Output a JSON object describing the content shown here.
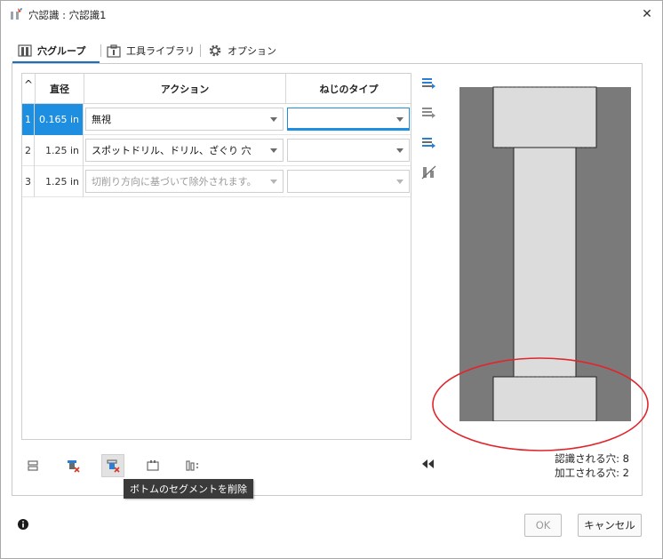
{
  "window": {
    "title": "穴認識 : 穴認識1",
    "close_glyph": "✕"
  },
  "tabs": [
    {
      "label": "穴グループ",
      "icon": "hole-group-icon",
      "active": true
    },
    {
      "label": "工具ライブラリ",
      "icon": "tool-library-icon",
      "active": false
    },
    {
      "label": "オプション",
      "icon": "gear-icon",
      "active": false
    }
  ],
  "grid": {
    "columns": [
      "",
      "直径",
      "アクション",
      "ねじのタイプ"
    ],
    "sort_glyph": "^",
    "rows": [
      {
        "num": "1",
        "diameter": "0.165 in",
        "action": "無視",
        "thread": "",
        "selected": true,
        "disabled": false
      },
      {
        "num": "2",
        "diameter": "1.25 in",
        "action": "スポットドリル、ドリル、ざぐり 穴",
        "thread": "",
        "selected": false,
        "disabled": false
      },
      {
        "num": "3",
        "diameter": "1.25 in",
        "action": "切削り方向に基づいて除外されます。",
        "thread": "",
        "selected": false,
        "disabled": true
      }
    ]
  },
  "side_icons": [
    "merge-groups-icon",
    "split-group-icon",
    "move-group-icon",
    "toggle-segments-icon"
  ],
  "bottom_toolbar": {
    "icons": [
      "segment-top-icon",
      "delete-top-segment-icon",
      "delete-bottom-segment-icon",
      "segment-edit-icon",
      "segment-align-icon"
    ],
    "tooltip": "ボトムのセグメントを削除"
  },
  "counts": {
    "recognized": "認識される穴: 8",
    "machined": "加工される穴: 2"
  },
  "footer": {
    "ok": "OK",
    "cancel": "キャンセル"
  },
  "colors": {
    "accent": "#1d8ee0",
    "tab_underline": "#1b6fc2",
    "stock": "#7a7a7a",
    "hole": "#dcdcdc",
    "highlight": "#e0262b"
  }
}
